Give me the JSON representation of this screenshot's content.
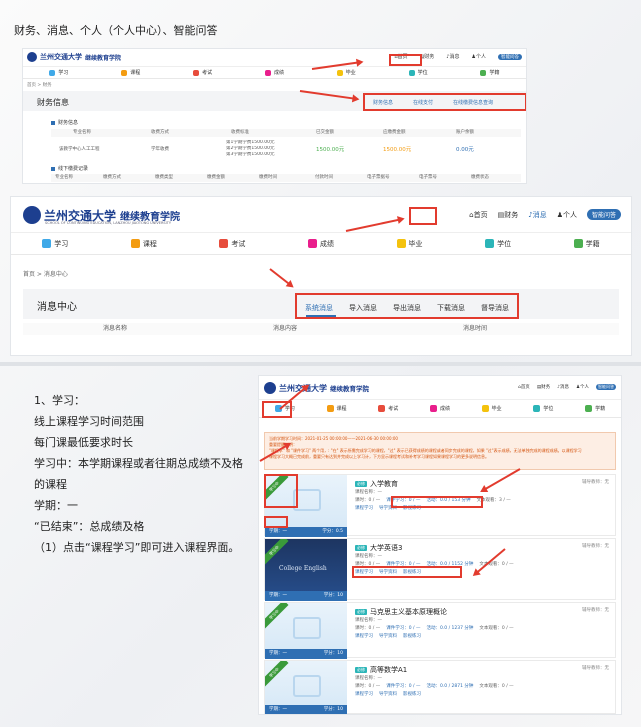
{
  "page_title": "财务、消息、个人（个人中心）、智能问答",
  "site": {
    "logo_name": "兰州交通大学",
    "logo_sub": "继续教育学院",
    "logo_en": "SCHOOL OF CONTINUING EDUCATION, LANZHOU JIAOTONG UNIVERSITY"
  },
  "toplinks": [
    "首页",
    "财务",
    "消息",
    "个人"
  ],
  "qa_button": "智能问答",
  "nav": [
    "学习",
    "课程",
    "考试",
    "成绩",
    "毕业",
    "学位",
    "学籍"
  ],
  "panel1": {
    "breadcrumb": "首页 > 财务",
    "section_title": "财务信息",
    "tabs": [
      "财务信息",
      "在线支付",
      "在线缴费信息查询"
    ],
    "table1_title": "财务信息",
    "table1_headers": [
      "专业名称",
      "收费方式",
      "收费标准",
      "已交金额",
      "应缴费金额",
      "账户余额"
    ],
    "table1_row": [
      "该教学中心人工工程",
      "学年收费",
      "第1学期学费1500.00元",
      "1500.00元",
      "1500.00元",
      "0.00元"
    ],
    "table1_extra": [
      "第2学期学费1500.00元",
      "第3学期学费1500.00元"
    ],
    "table2_title": "线下缴费记录",
    "table2_headers": [
      "专业名称",
      "缴费方式",
      "缴费类型",
      "缴费金额",
      "缴费时间",
      "付款时间",
      "电子票据号",
      "电子票号",
      "缴费状态"
    ]
  },
  "panel2": {
    "breadcrumb": "首页 > 消息中心",
    "section_title": "消息中心",
    "tabs": [
      "系统消息",
      "导入消息",
      "导出消息",
      "下载消息",
      "督导消息"
    ],
    "headers": [
      "消息名称",
      "消息内容",
      "消息时间"
    ]
  },
  "steps": {
    "lines": [
      "1、学习：",
      "线上课程学习时间范围",
      "每门课最低要求时长",
      "学习中：本学期课程或者往期总成绩不及格的课程",
      "学期：一",
      "“已结束”：总成绩及格",
      "（1）点击“课程学习”即可进入课程界面。"
    ]
  },
  "panel3": {
    "notice": [
      "当前学期学习时间：2021-01-25 00:00:00——2021-06-30 00:00:00",
      "重要提醒说明：",
      "\"课程学\" 和 \"课件学习\" 两个用，: \"在\" 表示所需完成学习的课程，\"过\" 表示已获得成绩的课程或者同步完成的课程，如果 \"过\"表示成绩，无法单独完成的课程成绩。以课程学习",
      "课程学习大概已完成前，重要只有达到并完成以上学习计，下方显示课程考试和补考学习课程如果课程学习的更多说明信息。"
    ],
    "courses": [
      {
        "tag": "必修",
        "title": "入学教育",
        "ribbon": "学习中",
        "term": "学期：一",
        "credit": "学分：0.5",
        "tutor": "辅导教师：无",
        "meta": "课程名称：—",
        "s1": "课时：0 / —",
        "s2": "课件学习：0 / —",
        "s3": "活动：0.0 / 153 分钟",
        "s4": "文本观看：3 / —",
        "a1": "课程学习",
        "a2": "导学资料",
        "a3": "影视练习"
      },
      {
        "tag": "必修",
        "title": "大学英语3",
        "ribbon": "学习中",
        "term": "学期：一",
        "credit": "学分：10",
        "tutor": "辅导教师：无",
        "meta": "课程名称：—",
        "s1": "课时：0 / —",
        "s2": "课件学习：0 / —",
        "s3": "活动：0.0 / 1152 分钟",
        "s4": "文本观看：0 / —",
        "a1": "课程学习",
        "a2": "导学资料",
        "a3": "影视练习",
        "cover": "College English"
      },
      {
        "tag": "必修",
        "title": "马克思主义基本原理概论",
        "ribbon": "学习中",
        "term": "学期：一",
        "credit": "学分：10",
        "tutor": "辅导教师：无",
        "meta": "课程名称：—",
        "s1": "课时：0 / —",
        "s2": "课件学习：0 / —",
        "s3": "活动：0.0 / 1237 分钟",
        "s4": "文本观看：0 / —",
        "a1": "课程学习",
        "a2": "导学资料",
        "a3": "影视练习"
      },
      {
        "tag": "必修",
        "title": "高等数学A1",
        "ribbon": "学习中",
        "term": "学期：一",
        "credit": "学分：10",
        "tutor": "辅导教师：无",
        "meta": "课程名称：—",
        "s1": "课时：0 / —",
        "s2": "课件学习：0 / —",
        "s3": "活动：0.0 / 2871 分钟",
        "s4": "文本观看：0 / —",
        "a1": "课程学习",
        "a2": "导学资料",
        "a3": "影视练习"
      }
    ]
  },
  "colors": {
    "accent": "#e23b2e",
    "brand": "#1d3f8f",
    "tab_active": "#2f6fb3",
    "green": "#3a9a3a",
    "money": "#4caf50",
    "orange": "#f39c12"
  }
}
